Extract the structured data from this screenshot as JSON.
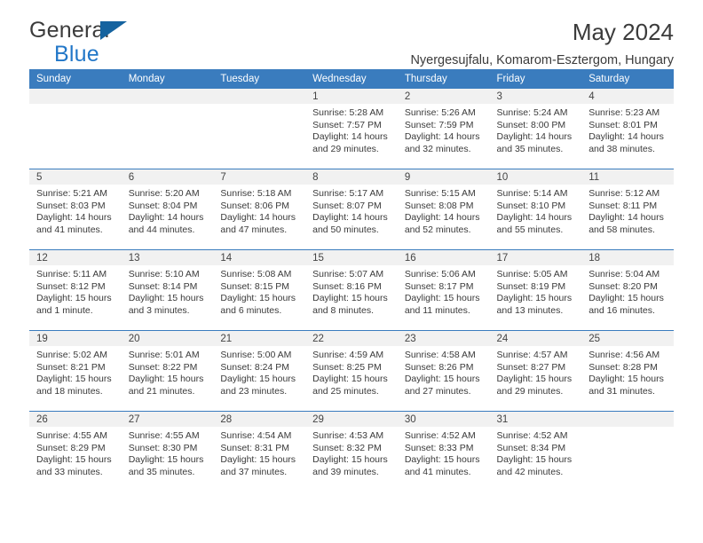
{
  "brand": {
    "name_top": "General",
    "name_bottom": "Blue",
    "triangle_icon": "blue-triangle-icon",
    "accent_color": "#2277c8",
    "triangle_color": "#15639f"
  },
  "header": {
    "title": "May 2024",
    "subtitle": "Nyergesujfalu, Komarom-Esztergom, Hungary"
  },
  "calendar": {
    "header_bg": "#3a7cbe",
    "daynum_bg": "#f1f1f1",
    "weekday_headers": [
      "Sunday",
      "Monday",
      "Tuesday",
      "Wednesday",
      "Thursday",
      "Friday",
      "Saturday"
    ],
    "weeks": [
      [
        {
          "day": "",
          "lines": []
        },
        {
          "day": "",
          "lines": []
        },
        {
          "day": "",
          "lines": []
        },
        {
          "day": "1",
          "lines": [
            "Sunrise: 5:28 AM",
            "Sunset: 7:57 PM",
            "Daylight: 14 hours",
            "and 29 minutes."
          ]
        },
        {
          "day": "2",
          "lines": [
            "Sunrise: 5:26 AM",
            "Sunset: 7:59 PM",
            "Daylight: 14 hours",
            "and 32 minutes."
          ]
        },
        {
          "day": "3",
          "lines": [
            "Sunrise: 5:24 AM",
            "Sunset: 8:00 PM",
            "Daylight: 14 hours",
            "and 35 minutes."
          ]
        },
        {
          "day": "4",
          "lines": [
            "Sunrise: 5:23 AM",
            "Sunset: 8:01 PM",
            "Daylight: 14 hours",
            "and 38 minutes."
          ]
        }
      ],
      [
        {
          "day": "5",
          "lines": [
            "Sunrise: 5:21 AM",
            "Sunset: 8:03 PM",
            "Daylight: 14 hours",
            "and 41 minutes."
          ]
        },
        {
          "day": "6",
          "lines": [
            "Sunrise: 5:20 AM",
            "Sunset: 8:04 PM",
            "Daylight: 14 hours",
            "and 44 minutes."
          ]
        },
        {
          "day": "7",
          "lines": [
            "Sunrise: 5:18 AM",
            "Sunset: 8:06 PM",
            "Daylight: 14 hours",
            "and 47 minutes."
          ]
        },
        {
          "day": "8",
          "lines": [
            "Sunrise: 5:17 AM",
            "Sunset: 8:07 PM",
            "Daylight: 14 hours",
            "and 50 minutes."
          ]
        },
        {
          "day": "9",
          "lines": [
            "Sunrise: 5:15 AM",
            "Sunset: 8:08 PM",
            "Daylight: 14 hours",
            "and 52 minutes."
          ]
        },
        {
          "day": "10",
          "lines": [
            "Sunrise: 5:14 AM",
            "Sunset: 8:10 PM",
            "Daylight: 14 hours",
            "and 55 minutes."
          ]
        },
        {
          "day": "11",
          "lines": [
            "Sunrise: 5:12 AM",
            "Sunset: 8:11 PM",
            "Daylight: 14 hours",
            "and 58 minutes."
          ]
        }
      ],
      [
        {
          "day": "12",
          "lines": [
            "Sunrise: 5:11 AM",
            "Sunset: 8:12 PM",
            "Daylight: 15 hours",
            "and 1 minute."
          ]
        },
        {
          "day": "13",
          "lines": [
            "Sunrise: 5:10 AM",
            "Sunset: 8:14 PM",
            "Daylight: 15 hours",
            "and 3 minutes."
          ]
        },
        {
          "day": "14",
          "lines": [
            "Sunrise: 5:08 AM",
            "Sunset: 8:15 PM",
            "Daylight: 15 hours",
            "and 6 minutes."
          ]
        },
        {
          "day": "15",
          "lines": [
            "Sunrise: 5:07 AM",
            "Sunset: 8:16 PM",
            "Daylight: 15 hours",
            "and 8 minutes."
          ]
        },
        {
          "day": "16",
          "lines": [
            "Sunrise: 5:06 AM",
            "Sunset: 8:17 PM",
            "Daylight: 15 hours",
            "and 11 minutes."
          ]
        },
        {
          "day": "17",
          "lines": [
            "Sunrise: 5:05 AM",
            "Sunset: 8:19 PM",
            "Daylight: 15 hours",
            "and 13 minutes."
          ]
        },
        {
          "day": "18",
          "lines": [
            "Sunrise: 5:04 AM",
            "Sunset: 8:20 PM",
            "Daylight: 15 hours",
            "and 16 minutes."
          ]
        }
      ],
      [
        {
          "day": "19",
          "lines": [
            "Sunrise: 5:02 AM",
            "Sunset: 8:21 PM",
            "Daylight: 15 hours",
            "and 18 minutes."
          ]
        },
        {
          "day": "20",
          "lines": [
            "Sunrise: 5:01 AM",
            "Sunset: 8:22 PM",
            "Daylight: 15 hours",
            "and 21 minutes."
          ]
        },
        {
          "day": "21",
          "lines": [
            "Sunrise: 5:00 AM",
            "Sunset: 8:24 PM",
            "Daylight: 15 hours",
            "and 23 minutes."
          ]
        },
        {
          "day": "22",
          "lines": [
            "Sunrise: 4:59 AM",
            "Sunset: 8:25 PM",
            "Daylight: 15 hours",
            "and 25 minutes."
          ]
        },
        {
          "day": "23",
          "lines": [
            "Sunrise: 4:58 AM",
            "Sunset: 8:26 PM",
            "Daylight: 15 hours",
            "and 27 minutes."
          ]
        },
        {
          "day": "24",
          "lines": [
            "Sunrise: 4:57 AM",
            "Sunset: 8:27 PM",
            "Daylight: 15 hours",
            "and 29 minutes."
          ]
        },
        {
          "day": "25",
          "lines": [
            "Sunrise: 4:56 AM",
            "Sunset: 8:28 PM",
            "Daylight: 15 hours",
            "and 31 minutes."
          ]
        }
      ],
      [
        {
          "day": "26",
          "lines": [
            "Sunrise: 4:55 AM",
            "Sunset: 8:29 PM",
            "Daylight: 15 hours",
            "and 33 minutes."
          ]
        },
        {
          "day": "27",
          "lines": [
            "Sunrise: 4:55 AM",
            "Sunset: 8:30 PM",
            "Daylight: 15 hours",
            "and 35 minutes."
          ]
        },
        {
          "day": "28",
          "lines": [
            "Sunrise: 4:54 AM",
            "Sunset: 8:31 PM",
            "Daylight: 15 hours",
            "and 37 minutes."
          ]
        },
        {
          "day": "29",
          "lines": [
            "Sunrise: 4:53 AM",
            "Sunset: 8:32 PM",
            "Daylight: 15 hours",
            "and 39 minutes."
          ]
        },
        {
          "day": "30",
          "lines": [
            "Sunrise: 4:52 AM",
            "Sunset: 8:33 PM",
            "Daylight: 15 hours",
            "and 41 minutes."
          ]
        },
        {
          "day": "31",
          "lines": [
            "Sunrise: 4:52 AM",
            "Sunset: 8:34 PM",
            "Daylight: 15 hours",
            "and 42 minutes."
          ]
        },
        {
          "day": "",
          "lines": []
        }
      ]
    ]
  }
}
